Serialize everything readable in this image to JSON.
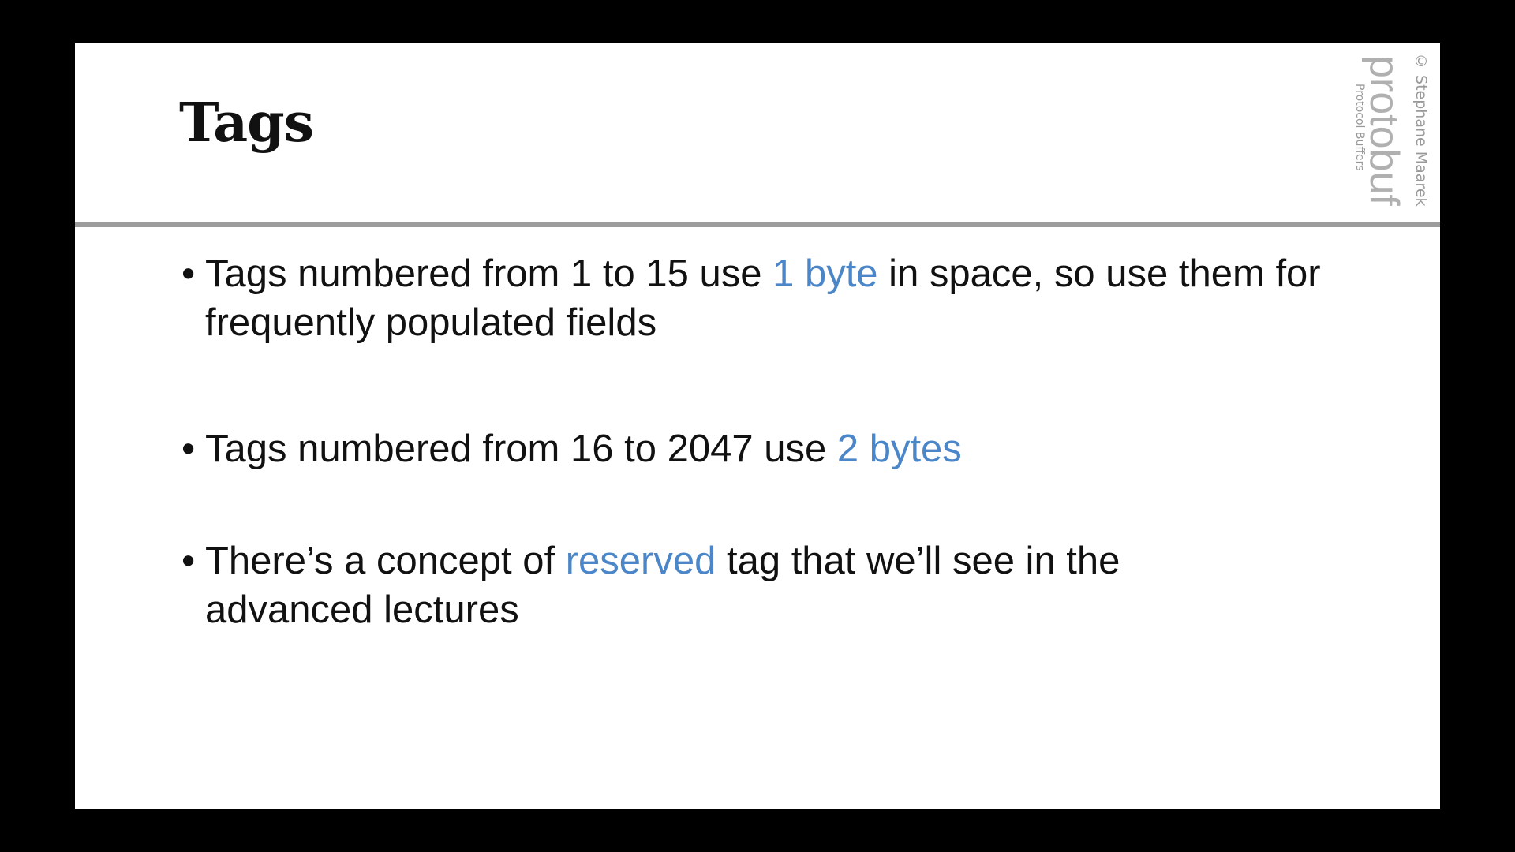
{
  "slide": {
    "title": "Tags",
    "watermark": {
      "copyright": "© Stephane Maarek",
      "logo": "protobuf",
      "logo_subtitle": "Protocol Buffers"
    },
    "bullets": [
      {
        "before": "Tags numbered from 1 to 15 use ",
        "highlight": "1 byte",
        "after": " in space, so use them for frequently populated fields"
      },
      {
        "before": "Tags numbered from 16 to 2047 use ",
        "highlight": "2 bytes",
        "after": ""
      },
      {
        "before": "There’s a concept of ",
        "highlight": "reserved",
        "after": " tag that we’ll see in the advanced lectures"
      }
    ],
    "colors": {
      "highlight": "#4a86c8",
      "divider": "#9c9c9c",
      "background": "#000000"
    }
  }
}
